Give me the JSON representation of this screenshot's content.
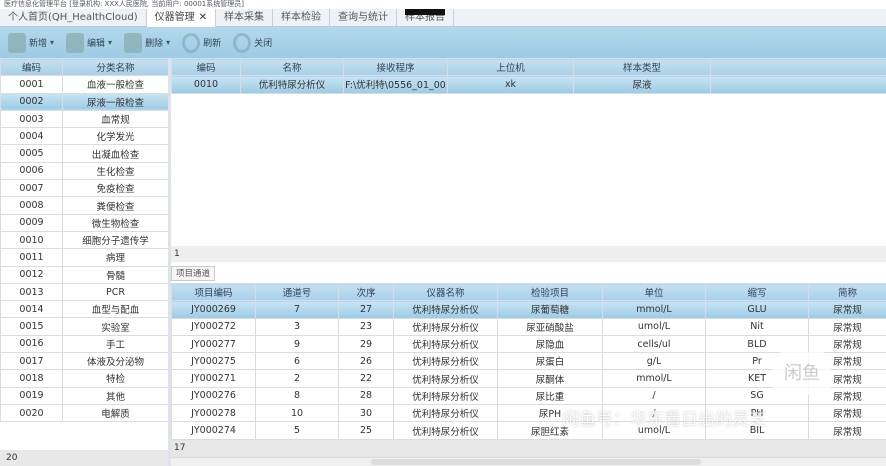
{
  "title_bar": "医疗信息化管理平台 [登录机构: XXX人民医院, 当前用户: 00001系统管理员]",
  "tabs": [
    {
      "label": "个人首页(QH_HealthCloud)"
    },
    {
      "label": "仪器管理",
      "close": "✕"
    },
    {
      "label": "样本采集"
    },
    {
      "label": "样本检验"
    },
    {
      "label": "查询与统计"
    },
    {
      "label": "样本报告"
    }
  ],
  "toolbar": {
    "add": "新增",
    "edit": "编辑",
    "delete": "删除",
    "refresh": "刷新",
    "close": "关闭",
    "dropdown": "▾"
  },
  "category_grid": {
    "headers": [
      "编码",
      "分类名称"
    ],
    "rows": [
      [
        "0001",
        "血液一般检查"
      ],
      [
        "0002",
        "尿液一般检查"
      ],
      [
        "0003",
        "血常规"
      ],
      [
        "0004",
        "化学发光"
      ],
      [
        "0005",
        "出凝血检查"
      ],
      [
        "0006",
        "生化检查"
      ],
      [
        "0007",
        "免疫检查"
      ],
      [
        "0008",
        "粪便检查"
      ],
      [
        "0009",
        "微生物检查"
      ],
      [
        "0010",
        "细胞分子遗传学"
      ],
      [
        "0011",
        "病理"
      ],
      [
        "0012",
        "骨髓"
      ],
      [
        "0013",
        "PCR"
      ],
      [
        "0014",
        "血型与配血"
      ],
      [
        "0015",
        "实验室"
      ],
      [
        "0016",
        "手工"
      ],
      [
        "0017",
        "体液及分泌物"
      ],
      [
        "0018",
        "特检"
      ],
      [
        "0019",
        "其他"
      ],
      [
        "0020",
        "电解质"
      ]
    ],
    "count": "20"
  },
  "instrument_grid": {
    "headers": [
      "编码",
      "名称",
      "接收程序",
      "上位机",
      "样本类型",
      ""
    ],
    "rows": [
      [
        "0010",
        "优利特尿分析仪",
        "F:\\优利特\\0556_01_00",
        "xk",
        "尿液",
        ""
      ]
    ],
    "count": "1"
  },
  "subtab": "项目通道",
  "channel_grid": {
    "headers": [
      "项目编码",
      "通道号",
      "次序",
      "仪器名称",
      "检验项目",
      "单位",
      "缩写",
      "简称"
    ],
    "rows": [
      [
        "JY000269",
        "7",
        "27",
        "优利特尿分析仪",
        "尿葡萄糖",
        "mmol/L",
        "GLU",
        "尿常规"
      ],
      [
        "JY000272",
        "3",
        "23",
        "优利特尿分析仪",
        "尿亚硝酸盐",
        "umol/L",
        "Nit",
        "尿常规"
      ],
      [
        "JY000277",
        "9",
        "29",
        "优利特尿分析仪",
        "尿隐血",
        "cells/ul",
        "BLD",
        "尿常规"
      ],
      [
        "JY000275",
        "6",
        "26",
        "优利特尿分析仪",
        "尿蛋白",
        "g/L",
        "Pr",
        "尿常规"
      ],
      [
        "JY000271",
        "2",
        "22",
        "优利特尿分析仪",
        "尿酮体",
        "mmol/L",
        "KET",
        "尿常规"
      ],
      [
        "JY000276",
        "8",
        "28",
        "优利特尿分析仪",
        "尿比重",
        "/",
        "SG",
        "尿常规"
      ],
      [
        "JY000278",
        "10",
        "30",
        "优利特尿分析仪",
        "尿PH",
        "/",
        "PH",
        "尿常规"
      ],
      [
        "JY000274",
        "5",
        "25",
        "优利特尿分析仪",
        "尿胆红素",
        "umol/L",
        "BIL",
        "尿常规"
      ]
    ],
    "count": "17"
  },
  "watermark": "闲鱼号：华东看日出的灵芝",
  "watermark_logo": "闲鱼"
}
